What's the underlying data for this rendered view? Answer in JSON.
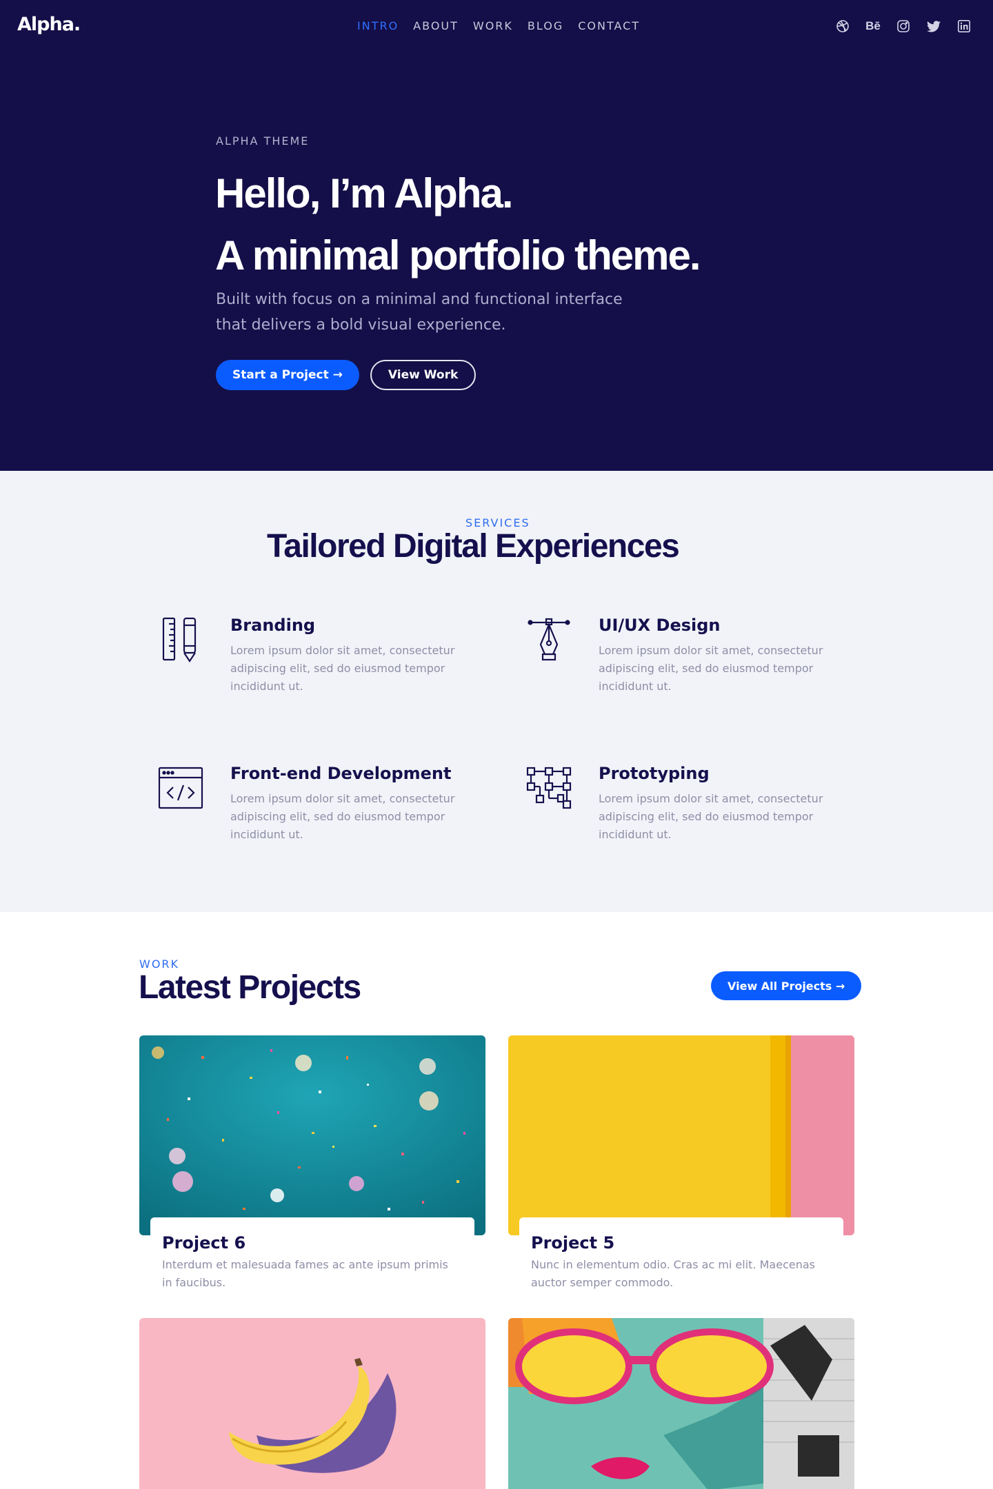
{
  "brand": {
    "logo": "Alpha."
  },
  "nav": {
    "items": [
      {
        "label": "INTRO",
        "active": true
      },
      {
        "label": "ABOUT"
      },
      {
        "label": "WORK"
      },
      {
        "label": "BLOG"
      },
      {
        "label": "CONTACT"
      }
    ]
  },
  "social": {
    "icons": [
      "dribbble-icon",
      "behance-icon",
      "instagram-icon",
      "twitter-icon",
      "linkedin-icon"
    ],
    "behance_text": "Bē"
  },
  "hero": {
    "kicker": "ALPHA THEME",
    "title_line1": "Hello, I’m Alpha.",
    "title_line2": "A minimal portfolio theme.",
    "subtitle_line1": "Built with focus on a minimal and functional interface",
    "subtitle_line2": "that delivers a bold visual experience.",
    "primary_button": "Start a Project →",
    "secondary_button": "View Work"
  },
  "services": {
    "kicker": "SERVICES",
    "title": "Tailored Digital Experiences",
    "items": [
      {
        "title": "Branding",
        "icon": "ruler-pencil-icon",
        "desc_line1": "Lorem ipsum dolor sit amet, consectetur",
        "desc_line2": "adipiscing elit, sed do eiusmod tempor",
        "desc_line3": "incididunt ut."
      },
      {
        "title": "UI/UX Design",
        "icon": "pen-tool-icon",
        "desc_line1": "Lorem ipsum dolor sit amet, consectetur",
        "desc_line2": "adipiscing elit, sed do eiusmod tempor",
        "desc_line3": "incididunt ut."
      },
      {
        "title": "Front-end Development",
        "icon": "code-window-icon",
        "desc_line1": "Lorem ipsum dolor sit amet, consectetur",
        "desc_line2": "adipiscing elit, sed do eiusmod tempor",
        "desc_line3": "incididunt ut."
      },
      {
        "title": "Prototyping",
        "icon": "flowchart-icon",
        "desc_line1": "Lorem ipsum dolor sit amet, consectetur",
        "desc_line2": "adipiscing elit, sed do eiusmod tempor",
        "desc_line3": "incididunt ut."
      }
    ]
  },
  "work": {
    "kicker": "WORK",
    "title": "Latest Projects",
    "view_all": "View All Projects →",
    "projects": [
      {
        "title": "Project 6",
        "desc_line1": "Interdum et malesuada fames ac ante ipsum primis",
        "desc_line2": "in faucibus."
      },
      {
        "title": "Project 5",
        "desc_line1": "Nunc in elementum odio. Cras ac mi elit. Maecenas",
        "desc_line2": "auctor semper commodo."
      }
    ]
  },
  "colors": {
    "hero_bg": "#140f48",
    "accent": "#0b5cff",
    "services_bg": "#f2f3f8",
    "heading": "#15104d"
  }
}
